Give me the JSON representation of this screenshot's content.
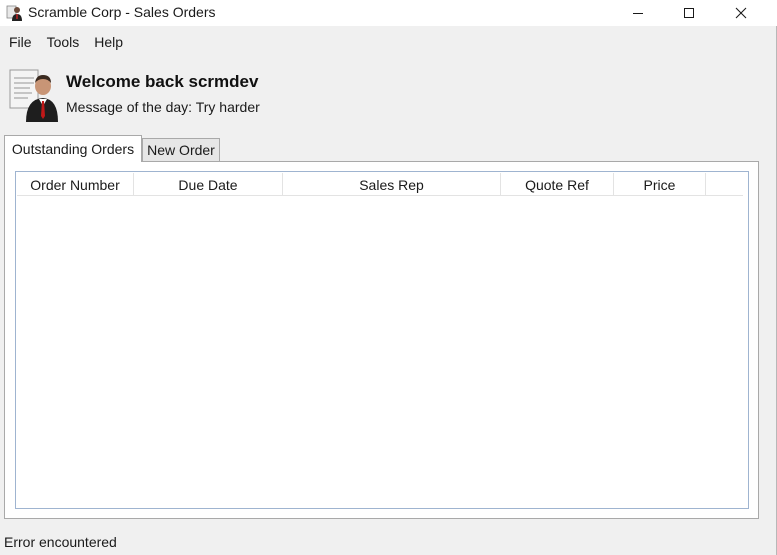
{
  "window": {
    "title": "Scramble Corp - Sales Orders",
    "app_icon": "user-icon"
  },
  "menu": {
    "items": [
      "File",
      "Tools",
      "Help"
    ]
  },
  "header": {
    "icon": "user-profile-icon",
    "welcome": "Welcome back scrmdev",
    "message_of_the_day": "Message of the day: Try harder"
  },
  "tabs": [
    {
      "label": "Outstanding Orders",
      "active": true
    },
    {
      "label": "New Order",
      "active": false
    }
  ],
  "orders_table": {
    "columns": [
      "Order Number",
      "Due Date",
      "Sales Rep",
      "Quote Ref",
      "Price"
    ],
    "rows": []
  },
  "status": {
    "text": "Error encountered"
  }
}
